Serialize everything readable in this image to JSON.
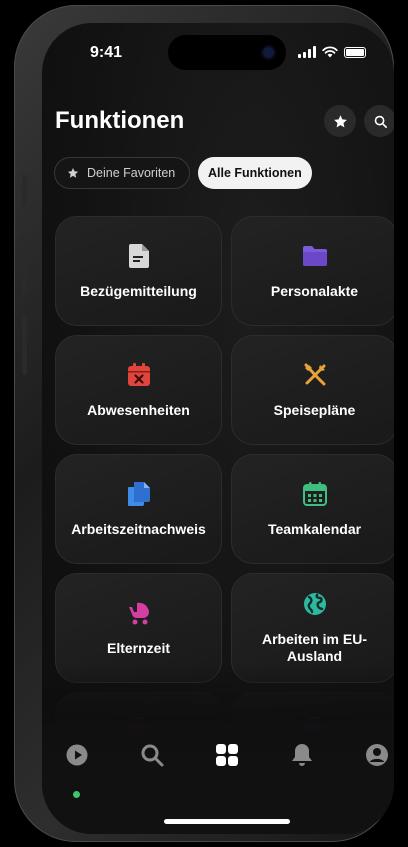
{
  "status": {
    "time": "9:41"
  },
  "header": {
    "title": "Funktionen"
  },
  "tabs": [
    {
      "label": "Deine Favoriten",
      "active": false
    },
    {
      "label": "Alle Funktionen",
      "active": true
    }
  ],
  "tiles": [
    {
      "label": "Bezügemitteilung",
      "icon": "document-icon",
      "color": "#d8d8d8"
    },
    {
      "label": "Personalakte",
      "icon": "folder-icon",
      "color": "#7c5cd6"
    },
    {
      "label": "Abwesenheiten",
      "icon": "calendar-x-icon",
      "color": "#e0443c"
    },
    {
      "label": "Speisepläne",
      "icon": "utensils-icon",
      "color": "#e8a23a"
    },
    {
      "label": "Arbeitszeitnachweis",
      "icon": "documents-icon",
      "color": "#3f8be8"
    },
    {
      "label": "Teamkalendar",
      "icon": "calendar-grid-icon",
      "color": "#3fbf7f"
    },
    {
      "label": "Elternzeit",
      "icon": "baby-carriage-icon",
      "color": "#d23fa0"
    },
    {
      "label": "Arbeiten im EU-Ausland",
      "icon": "globe-icon",
      "color": "#2fb8a0"
    }
  ],
  "faded_tiles": [
    {
      "icon": "briefcase-icon",
      "color": "#c0392b"
    },
    {
      "icon": "briefcase-icon",
      "color": "#8e44ad"
    }
  ],
  "tabbar": {
    "items": [
      "play-circle-icon",
      "search-icon",
      "grid-icon",
      "bell-icon",
      "profile-icon"
    ],
    "active_index": 2,
    "indicator_color": "#3ec46d"
  }
}
